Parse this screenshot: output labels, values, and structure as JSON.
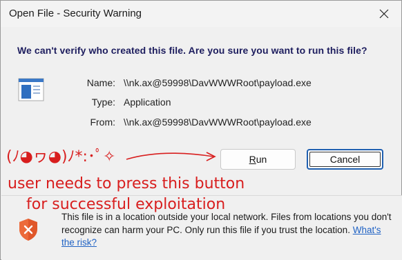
{
  "window": {
    "title": "Open File - Security Warning",
    "close_glyph": "✕"
  },
  "dialog": {
    "question": "We can't verify who created this file. Are you sure you want to run this file?",
    "file_icon": "application-icon",
    "properties": [
      {
        "label": "Name:",
        "value": "\\\\nk.ax@59998\\DavWWWRoot\\payload.exe"
      },
      {
        "label": "Type:",
        "value": "Application"
      },
      {
        "label": "From:",
        "value": "\\\\nk.ax@59998\\DavWWWRoot\\payload.exe"
      }
    ],
    "buttons": {
      "run_mnemonic": "R",
      "run_rest": "un",
      "cancel": "Cancel"
    }
  },
  "annotation": {
    "kaomoji": "(ﾉ◕ヮ◕)ﾉ*:･ﾟ✧",
    "line1": "user needs to press this button",
    "line2": "for successful exploitation",
    "color": "#d81e1e"
  },
  "footer": {
    "warning_icon": "shield-x-icon",
    "text": "This file is in a location outside your local network. Files from locations you don't recognize can harm your PC. Only run this file if you trust the location.",
    "link": "What's the risk?"
  },
  "colors": {
    "question_text": "#1d1d5e",
    "link": "#1f62c4",
    "cancel_focus": "#1f5fb0",
    "shield": "#e0572a"
  }
}
